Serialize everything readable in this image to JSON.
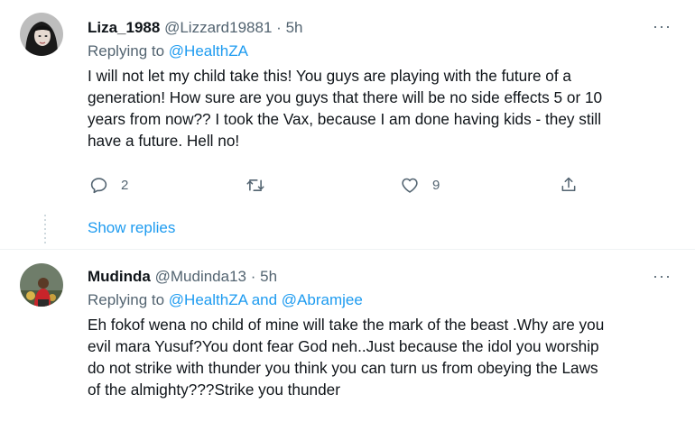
{
  "tweets": [
    {
      "name": "Liza_1988",
      "handle": "@Lizzard19881",
      "dot": "·",
      "time": "5h",
      "replying_prefix": "Replying to",
      "replying_to": "@HealthZA",
      "body_lines": [
        "I will not let my child take this! You guys are playing with the future of a",
        "generation! How sure are you guys that there will be no side effects 5 or 10",
        "years from now?? I took the Vax, because I am done having kids - they still",
        "have a future. Hell no!"
      ],
      "more": "···",
      "reply_count": "2",
      "retweet_count": "",
      "like_count": "9"
    },
    {
      "name": "Mudinda",
      "handle": "@Mudinda13",
      "dot": "·",
      "time": "5h",
      "replying_prefix": "Replying to",
      "replying_to": "@HealthZA and @Abramjee",
      "body_lines": [
        "Eh fokof wena no child of mine will take the mark of the beast .Why are you",
        "evil mara Yusuf?You dont fear God neh..Just because the idol you worship",
        "do not strike with thunder you think you can turn us from obeying the Laws",
        "of the almighty???Strike you thunder"
      ],
      "more": "···"
    }
  ],
  "show_replies": "Show replies",
  "icons": {
    "reply": "reply-icon",
    "retweet": "retweet-icon",
    "like": "heart-icon",
    "share": "share-icon",
    "more": "more-options-icon"
  },
  "colors": {
    "link": "#1d9bf0",
    "muted": "#536471",
    "text": "#0f1419"
  }
}
